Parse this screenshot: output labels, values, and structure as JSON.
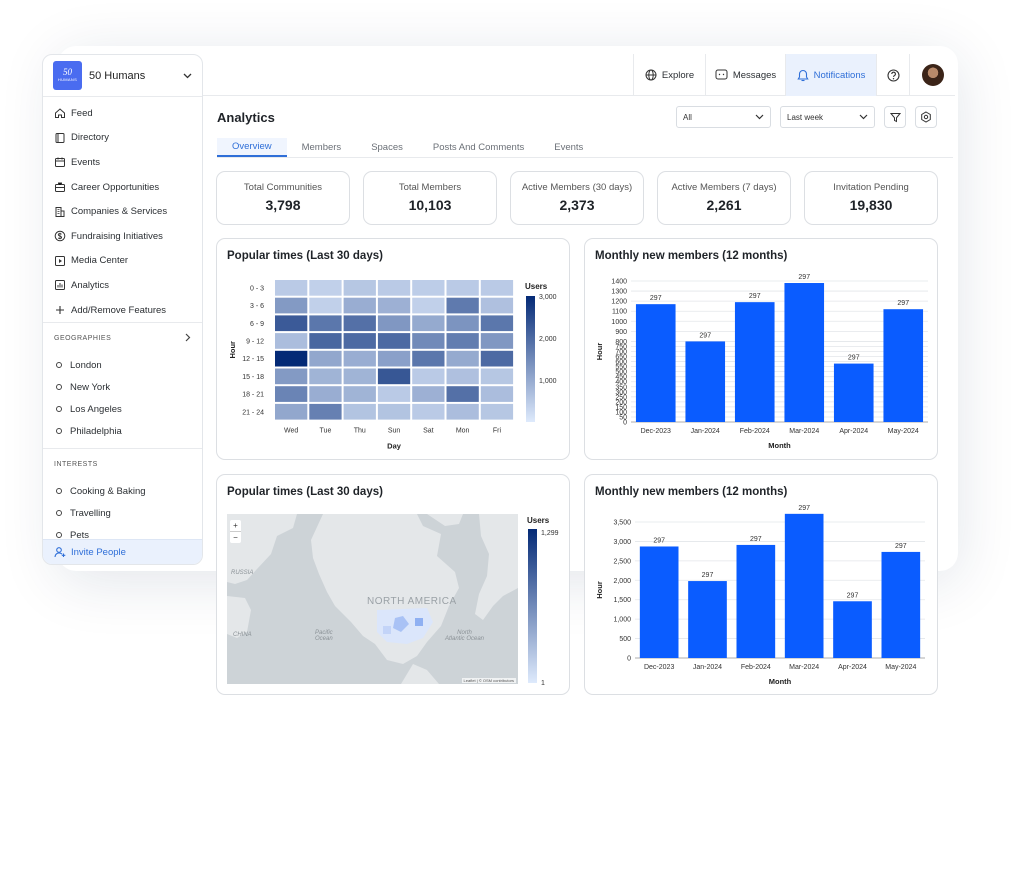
{
  "sidebar": {
    "brand": {
      "logo_number": "50",
      "logo_word": "HUMANS",
      "name": "50 Humans"
    },
    "nav": [
      {
        "label": "Feed",
        "icon": "home-icon"
      },
      {
        "label": "Directory",
        "icon": "book-icon"
      },
      {
        "label": "Events",
        "icon": "calendar-icon"
      },
      {
        "label": "Career Opportunities",
        "icon": "briefcase-icon"
      },
      {
        "label": "Companies & Services",
        "icon": "building-icon"
      },
      {
        "label": "Fundraising Initiatives",
        "icon": "dollar-icon"
      },
      {
        "label": "Media Center",
        "icon": "play-icon"
      },
      {
        "label": "Analytics",
        "icon": "chart-icon"
      },
      {
        "label": "Add/Remove Features",
        "icon": "plus-icon"
      }
    ],
    "geographies": {
      "title": "GEOGRAPHIES",
      "items": [
        "London",
        "New York",
        "Los Angeles",
        "Philadelphia"
      ]
    },
    "interests": {
      "title": "INTERESTS",
      "items": [
        "Cooking & Baking",
        "Travelling",
        "Pets"
      ]
    },
    "invite": "Invite People"
  },
  "topbar": {
    "explore": "Explore",
    "messages": "Messages",
    "notifications": "Notifications"
  },
  "main": {
    "title": "Analytics",
    "filter_all": "All",
    "filter_period": "Last week",
    "tabs": [
      "Overview",
      "Members",
      "Spaces",
      "Posts And Comments",
      "Events"
    ],
    "active_tab": "Overview",
    "stats": [
      {
        "label": "Total Communities",
        "value": "3,798"
      },
      {
        "label": "Total Members",
        "value": "10,103"
      },
      {
        "label": "Active Members (30 days)",
        "value": "2,373"
      },
      {
        "label": "Active Members (7 days)",
        "value": "2,261"
      },
      {
        "label": "Invitation Pending",
        "value": "19,830"
      }
    ],
    "heatmap_title": "Popular times (Last 30 days)",
    "map_title": "Popular times (Last 30 days)",
    "bar1_title": "Monthly new members (12 months)",
    "bar2_title": "Monthly new members (12 months)",
    "map_labels": {
      "north_america": "NORTH AMERICA",
      "pacific": "Pacific\nOcean",
      "atlantic": "North\nAtlantic Ocean",
      "russia": "RUSSIA",
      "china": "CHINA",
      "attribution": "Leaflet | © OSM contributors"
    }
  },
  "chart_data": [
    {
      "type": "heatmap",
      "title": "Popular times (Last 30 days)",
      "xlabel": "Day",
      "ylabel": "Hour",
      "x": [
        "Wed",
        "Tue",
        "Thu",
        "Sun",
        "Sat",
        "Mon",
        "Fri"
      ],
      "y": [
        "0 - 3",
        "3 - 6",
        "6 - 9",
        "9 - 12",
        "12 - 15",
        "15 - 18",
        "18 - 21",
        "21 - 24"
      ],
      "values": [
        [
          500,
          400,
          550,
          500,
          450,
          500,
          500
        ],
        [
          1250,
          400,
          950,
          900,
          400,
          1750,
          650
        ],
        [
          2250,
          1800,
          1900,
          1300,
          1000,
          1350,
          1800
        ],
        [
          700,
          2050,
          2000,
          2000,
          1500,
          1700,
          1300
        ],
        [
          3000,
          1050,
          950,
          1150,
          1800,
          1000,
          2000
        ],
        [
          1250,
          850,
          850,
          2300,
          500,
          650,
          550
        ],
        [
          1600,
          950,
          850,
          500,
          900,
          1900,
          700
        ],
        [
          1050,
          1650,
          600,
          600,
          500,
          700,
          550
        ]
      ],
      "colorbar": {
        "label": "Users",
        "ticks": [
          "3,000",
          "2,000",
          "1,000"
        ],
        "min": 0,
        "max": 3000
      }
    },
    {
      "type": "bar",
      "title": "Monthly new members (12 months)",
      "xlabel": "Month",
      "ylabel": "Hour",
      "categories": [
        "Dec-2023",
        "Jan-2024",
        "Feb-2024",
        "Mar-2024",
        "Apr-2024",
        "May-2024"
      ],
      "values": [
        1170,
        800,
        1190,
        1380,
        580,
        1120
      ],
      "data_labels": [
        "297",
        "297",
        "297",
        "297",
        "297",
        "297"
      ],
      "ylim": [
        0,
        1400
      ],
      "yticks": [
        "0",
        "50",
        "100",
        "150",
        "200",
        "250",
        "300",
        "350",
        "400",
        "450",
        "500",
        "550",
        "600",
        "650",
        "700",
        "750",
        "800",
        "900",
        "1000",
        "1100",
        "1200",
        "1300",
        "1400"
      ],
      "grid": true
    },
    {
      "type": "choropleth",
      "title": "Popular times (Last 30 days)",
      "colorbar": {
        "label": "Users",
        "ticks": [
          "1,299",
          "1"
        ],
        "min": 1,
        "max": 1299
      }
    },
    {
      "type": "bar",
      "title": "Monthly new members (12 months)",
      "xlabel": "Month",
      "ylabel": "Hour",
      "categories": [
        "Dec-2023",
        "Jan-2024",
        "Feb-2024",
        "Mar-2024",
        "Apr-2024",
        "May-2024"
      ],
      "values": [
        2870,
        1980,
        2910,
        3710,
        1460,
        2730
      ],
      "data_labels": [
        "297",
        "297",
        "297",
        "297",
        "297",
        "297"
      ],
      "ylim": [
        0,
        3500
      ],
      "yticks": [
        "0",
        "500",
        "1,000",
        "1,500",
        "2,000",
        "2,500",
        "3,000",
        "3,500"
      ],
      "grid": true
    }
  ],
  "colors": {
    "accent": "#2f6fd8",
    "bar": "#0a5cff",
    "active_bg": "#eaf1fd"
  }
}
